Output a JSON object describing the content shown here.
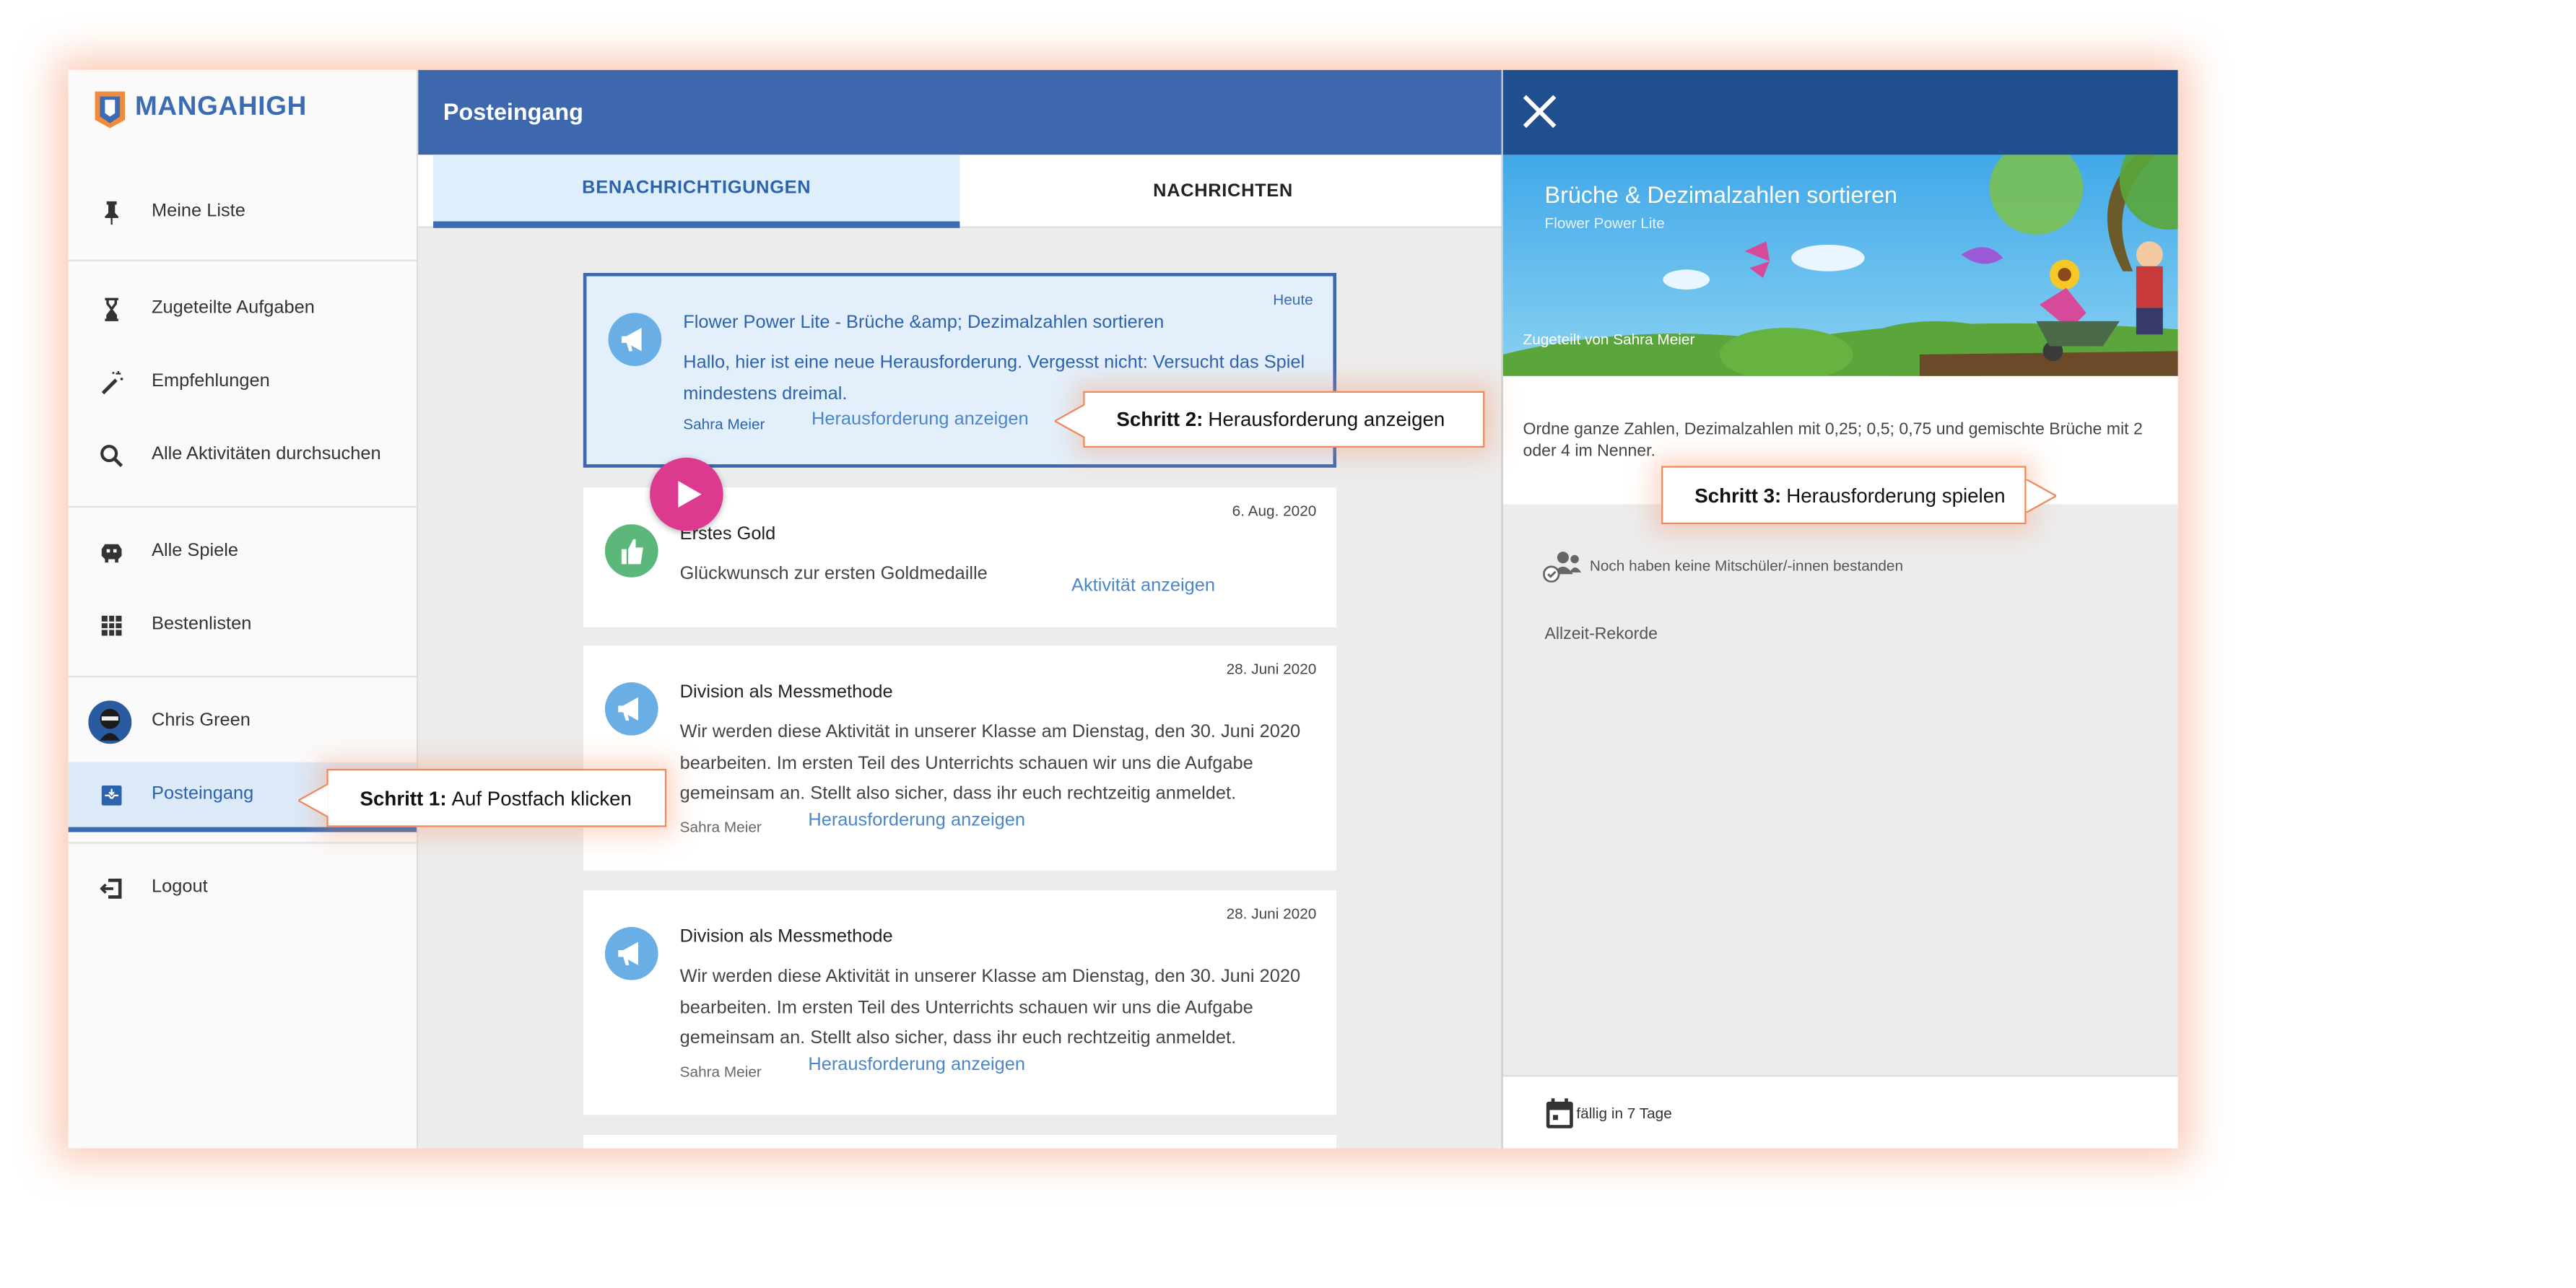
{
  "sidebar": {
    "logo_text": "MANGAHIGH",
    "items": [
      {
        "label": "Meine Liste",
        "icon": "pin-icon"
      },
      {
        "label": "Zugeteilte Aufgaben",
        "icon": "hourglass-icon"
      },
      {
        "label": "Empfehlungen",
        "icon": "magic-wand-icon"
      },
      {
        "label": "Alle Aktivitäten durchsuchen",
        "icon": "search-icon"
      },
      {
        "label": "Alle Spiele",
        "icon": "game-icon"
      },
      {
        "label": "Bestenlisten",
        "icon": "leaderboard-icon"
      },
      {
        "label": "Chris Green",
        "icon": "user-avatar"
      },
      {
        "label": "Posteingang",
        "icon": "inbox-icon"
      },
      {
        "label": "Logout",
        "icon": "logout-icon"
      }
    ]
  },
  "inbox": {
    "title": "Posteingang",
    "tabs": [
      {
        "label": "BENACHRICHTIGUNGEN"
      },
      {
        "label": "NACHRICHTEN"
      }
    ],
    "cards": [
      {
        "date": "Heute",
        "title": "Flower Power Lite - Brüche &amp; Dezimalzahlen sortieren",
        "body": "Hallo, hier ist eine neue Herausforderung. Vergesst nicht: Versucht das Spiel mindestens dreimal.",
        "sender": "Sahra Meier",
        "link": "Herausforderung anzeigen",
        "icon": "megaphone-icon"
      },
      {
        "date": "6. Aug. 2020",
        "title": "Erstes Gold",
        "body": "Glückwunsch zur ersten Goldmedaille",
        "link": "Aktivität anzeigen",
        "icon": "thumbs-up-icon"
      },
      {
        "date": "28. Juni 2020",
        "title": "Division als Messmethode",
        "body": "Wir werden diese Aktivität in unserer Klasse am Dienstag, den 30. Juni 2020 bearbeiten. Im ersten Teil des Unterrichts schauen wir uns die Aufgabe gemeinsam an. Stellt also sicher, dass ihr euch rechtzeitig anmeldet.",
        "sender": "Sahra Meier",
        "link": "Herausforderung anzeigen",
        "icon": "megaphone-icon"
      },
      {
        "date": "28. Juni 2020",
        "title": "Division als Messmethode",
        "body": "Wir werden diese Aktivität in unserer Klasse am Dienstag, den 30. Juni 2020 bearbeiten. Im ersten Teil des Unterrichts schauen wir uns die Aufgabe gemeinsam an. Stellt also sicher, dass ihr euch rechtzeitig anmeldet.",
        "sender": "Sahra Meier",
        "link": "Herausforderung anzeigen",
        "icon": "megaphone-icon"
      }
    ]
  },
  "detail": {
    "game_title": "Brüche & Dezimalzahlen sortieren",
    "game_subtitle": "Flower Power Lite",
    "assigned_by": "Zugeteilt von Sahra Meier",
    "description": "Ordne ganze Zahlen, Dezimalzahlen mit 0,25; 0,5; 0,75 und gemischte Brüche mit 2 oder 4 im Nenner.",
    "no_classmates": "Noch haben keine Mitschüler/-innen bestanden",
    "records_label": "Allzeit-Rekorde",
    "due": "fällig in 7 Tage"
  },
  "callouts": {
    "step1": {
      "bold": "Schritt 1:",
      "text": "Auf Postfach klicken"
    },
    "step2": {
      "bold": "Schritt 2:",
      "text": "Herausforderung anzeigen"
    },
    "step3": {
      "bold": "Schritt 3:",
      "text": "Herausforderung spielen"
    }
  },
  "colors": {
    "brand_blue": "#3d68ae",
    "dark_header": "#1f4f8e",
    "play_pink": "#dc3a8f",
    "callout_border": "#f08a5c"
  }
}
